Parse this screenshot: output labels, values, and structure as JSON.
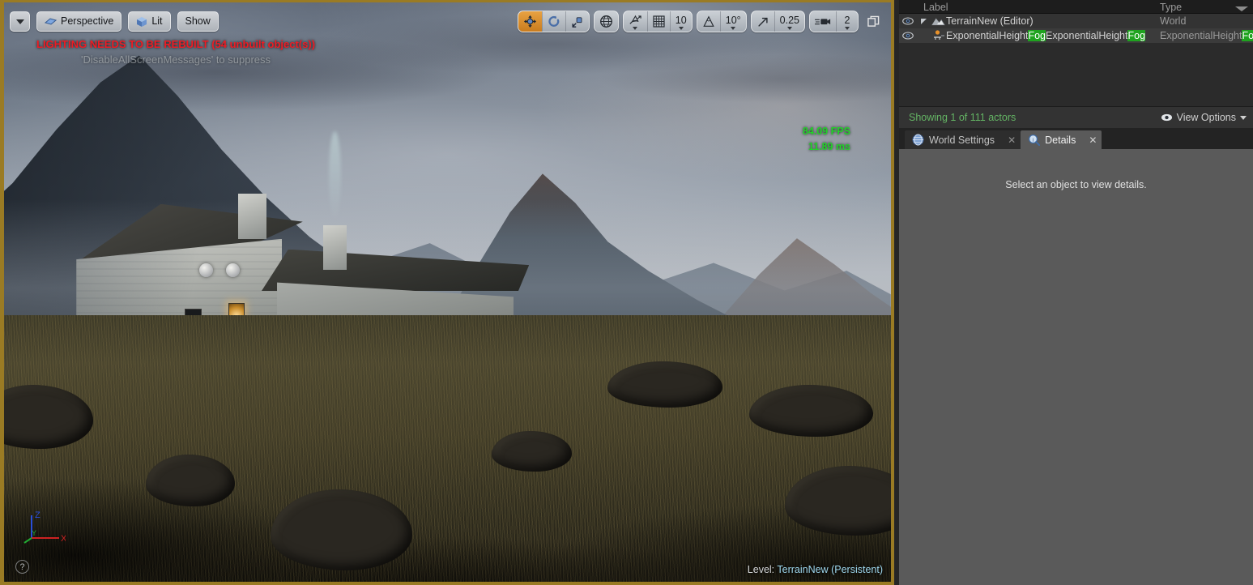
{
  "viewport": {
    "camera_dropdown_icon": "chevron-down-icon",
    "view_mode_label": "Perspective",
    "view_mode_icon": "perspective-camera-icon",
    "lit_label": "Lit",
    "lit_icon": "lit-cube-icon",
    "show_label": "Show",
    "lighting_warning": "LIGHTING NEEDS TO BE REBUILT (54 unbuilt object(s))",
    "suppress_message": "'DisableAllScreenMessages' to suppress",
    "fps": "84.09 FPS",
    "frame_time": "11.89 ms",
    "level_label": "Level:",
    "level_name": "TerrainNew (Persistent)",
    "help_glyph": "?",
    "axis": {
      "x": "X",
      "y": "Y",
      "z": "Z",
      "x_color": "#cc2222",
      "y_color": "#22aa33",
      "z_color": "#2a4fd8"
    },
    "warning_color": "#ec1c24",
    "fps_color": "#23d12a",
    "border_color": "#9a7b24"
  },
  "viewport_toolbar": {
    "transform_group": [
      {
        "name": "translate-mode-button",
        "icon": "move-gizmo-icon",
        "active": true
      },
      {
        "name": "rotate-mode-button",
        "icon": "rotate-gizmo-icon",
        "active": false
      },
      {
        "name": "scale-mode-button",
        "icon": "scale-gizmo-icon",
        "active": false
      }
    ],
    "coordinate_system": {
      "name": "world-coordinate-button",
      "icon": "globe-icon"
    },
    "snap_group": [
      {
        "name": "surface-snap-button",
        "icon": "surface-snap-icon",
        "value": ""
      },
      {
        "name": "grid-snap-toggle",
        "icon": "grid-icon",
        "value": ""
      },
      {
        "name": "grid-snap-value",
        "icon": "",
        "value": "10"
      }
    ],
    "rotation_group": [
      {
        "name": "angle-snap-toggle",
        "icon": "angle-icon",
        "value": ""
      },
      {
        "name": "angle-snap-value",
        "icon": "",
        "value": "10°"
      }
    ],
    "scale_group": [
      {
        "name": "scale-snap-toggle",
        "icon": "scale-arrow-icon",
        "value": ""
      },
      {
        "name": "scale-snap-value",
        "icon": "",
        "value": "0.25"
      }
    ],
    "camera_group": [
      {
        "name": "camera-speed-toggle",
        "icon": "camera-speed-icon",
        "value": ""
      },
      {
        "name": "camera-speed-value",
        "icon": "",
        "value": "2"
      }
    ],
    "maximize": {
      "name": "maximize-viewport-button",
      "icon": "maximize-icon"
    }
  },
  "outliner": {
    "columns": {
      "label": "Label",
      "type": "Type"
    },
    "sort_icon": "sort-descending-icon",
    "rows": [
      {
        "visibility_icon": "eye-icon",
        "expander_icon": "expander-collapsed-icon",
        "type_icon": "world-terrain-icon",
        "label_pre": "TerrainNew (Editor)",
        "label_hl": "",
        "label_post": "",
        "type_pre": "World",
        "type_hl": "",
        "type_post": ""
      },
      {
        "visibility_icon": "eye-icon",
        "expander_icon": "",
        "type_icon": "fog-actor-icon",
        "label_pre": "ExponentialHeight",
        "label_hl": "Fog",
        "label_post": "ExponentialHeight",
        "label_hl2": "Fog",
        "type_pre": "ExponentialHeight",
        "type_hl": "Fog",
        "type_post": ""
      }
    ],
    "footer": {
      "count_text": "Showing 1 of 111 actors",
      "count_color": "#64b464",
      "view_options_label": "View Options",
      "view_options_icon": "eye-icon",
      "view_options_caret": "caret-down-icon"
    }
  },
  "details": {
    "tabs": [
      {
        "label": "World Settings",
        "icon": "globe-icon",
        "active": false,
        "close_icon": "close-icon"
      },
      {
        "label": "Details",
        "icon": "details-magnifier-icon",
        "active": true,
        "close_icon": "close-icon"
      }
    ],
    "empty_message": "Select an object to view details."
  }
}
